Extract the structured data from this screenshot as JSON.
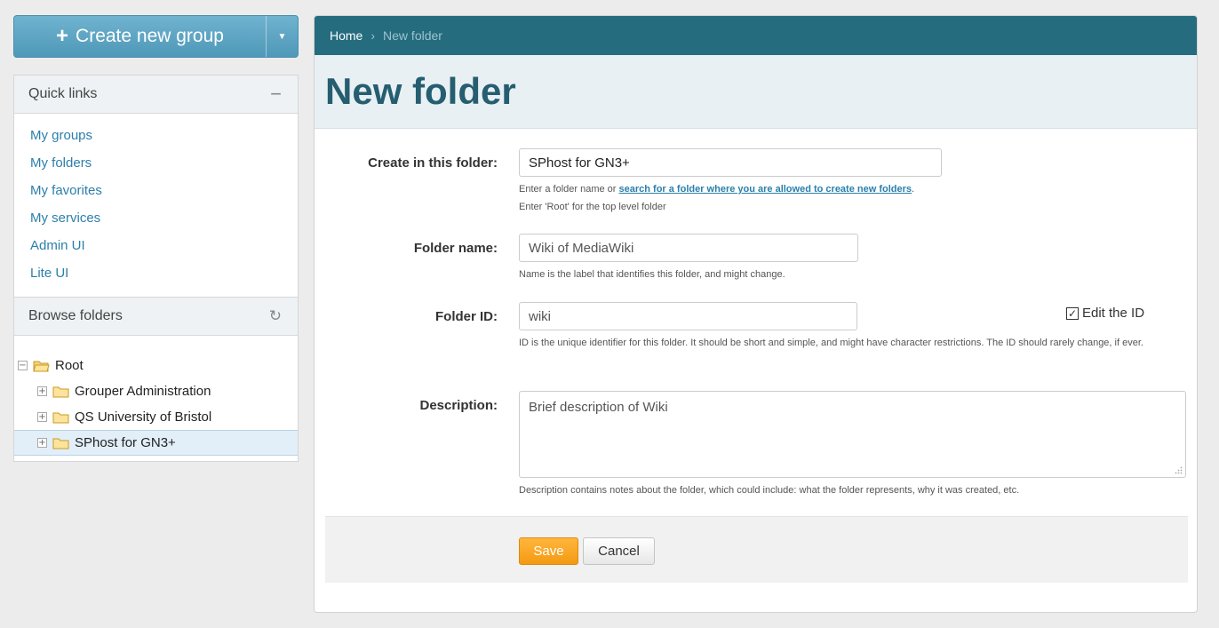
{
  "sidebar": {
    "create_button": {
      "label": "Create new group"
    },
    "quick_links": {
      "title": "Quick links",
      "items": [
        "My groups",
        "My folders",
        "My favorites",
        "My services",
        "Admin UI",
        "Lite UI"
      ]
    },
    "browse": {
      "title": "Browse folders",
      "tree": {
        "root": "Root",
        "children": [
          "Grouper Administration",
          "QS University of Bristol",
          "SPhost for GN3+"
        ],
        "selected": "SPhost for GN3+"
      }
    }
  },
  "breadcrumb": {
    "home": "Home",
    "separator": "›",
    "current": "New folder"
  },
  "page": {
    "title": "New folder"
  },
  "form": {
    "parent": {
      "label": "Create in this folder:",
      "value": "SPhost for GN3+",
      "help_prefix": "Enter a folder name or ",
      "help_link": "search for a folder where you are allowed to create new folders",
      "help_suffix": ".",
      "help_line2": "Enter 'Root' for the top level folder"
    },
    "name": {
      "label": "Folder name:",
      "value": "Wiki of MediaWiki",
      "help": "Name is the label that identifies this folder, and might change."
    },
    "id": {
      "label": "Folder ID:",
      "value": "wiki",
      "checkbox_label": "Edit the ID",
      "checkbox_checked": true,
      "help": "ID is the unique identifier for this folder. It should be short and simple, and might have character restrictions. The ID should rarely change, if ever."
    },
    "description": {
      "label": "Description:",
      "value": "Brief description of Wiki",
      "help": "Description contains notes about the folder, which could include: what the folder represents, why it was created, etc."
    },
    "save_label": "Save",
    "cancel_label": "Cancel"
  },
  "colors": {
    "accent": "#256c7e",
    "link": "#2b7fab",
    "save_button": "#f39a12",
    "create_button": "#5ca5c4"
  }
}
